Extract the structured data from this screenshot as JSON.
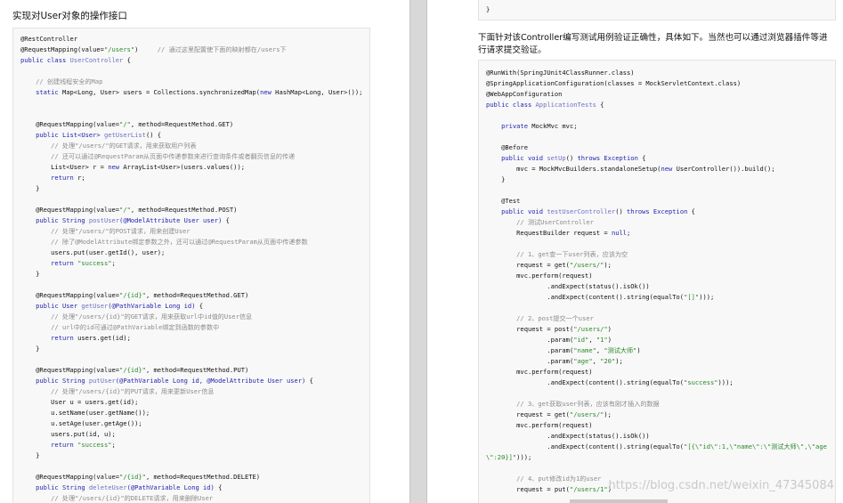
{
  "left_page": {
    "heading": "实现对User对象的操作接口",
    "lines": [
      [
        {
          "t": "@RestController",
          "c": "ann"
        }
      ],
      [
        {
          "t": "@RequestMapping(value=",
          "c": "ann"
        },
        {
          "t": "\"/users\"",
          "c": "str"
        },
        {
          "t": ")",
          "c": "ann"
        },
        {
          "t": "     // 通过这里配置使下面的映射都在/users下",
          "c": "cm"
        }
      ],
      [
        {
          "t": "public class ",
          "c": "kw"
        },
        {
          "t": "UserController",
          "c": "fn"
        },
        {
          "t": " {",
          "c": ""
        }
      ],
      [],
      [
        {
          "t": "    // 创建线程安全的Map",
          "c": "cm"
        }
      ],
      [
        {
          "t": "    static ",
          "c": "kw"
        },
        {
          "t": "Map<Long, User> users = Collections.synchronizedMap(",
          "c": ""
        },
        {
          "t": "new ",
          "c": "kw"
        },
        {
          "t": "HashMap<Long, User>());",
          "c": ""
        }
      ],
      [],
      [],
      [
        {
          "t": "    @RequestMapping(value=",
          "c": "ann"
        },
        {
          "t": "\"/\"",
          "c": "str"
        },
        {
          "t": ", method=RequestMethod.GET)",
          "c": "ann"
        }
      ],
      [
        {
          "t": "    public ",
          "c": "kw"
        },
        {
          "t": "List<User>",
          "c": "ty"
        },
        {
          "t": " getUserList",
          "c": "fn"
        },
        {
          "t": "() {",
          "c": ""
        }
      ],
      [
        {
          "t": "        // 处理\"/users/\"的GET请求，用来获取用户列表",
          "c": "cm"
        }
      ],
      [
        {
          "t": "        // 还可以通过@RequestParam从页面中传递参数来进行查询条件或者翻页信息的传递",
          "c": "cm"
        }
      ],
      [
        {
          "t": "        List<User> r = ",
          "c": ""
        },
        {
          "t": "new ",
          "c": "kw"
        },
        {
          "t": "ArrayList<User>(users.values());",
          "c": ""
        }
      ],
      [
        {
          "t": "        return ",
          "c": "kw"
        },
        {
          "t": "r;",
          "c": ""
        }
      ],
      [
        {
          "t": "    }",
          "c": ""
        }
      ],
      [],
      [
        {
          "t": "    @RequestMapping(value=",
          "c": "ann"
        },
        {
          "t": "\"/\"",
          "c": "str"
        },
        {
          "t": ", method=RequestMethod.POST)",
          "c": "ann"
        }
      ],
      [
        {
          "t": "    public ",
          "c": "kw"
        },
        {
          "t": "String",
          "c": "ty"
        },
        {
          "t": " postUser",
          "c": "fn"
        },
        {
          "t": "(@ModelAttribute User user)",
          "c": "kw"
        },
        {
          "t": " {",
          "c": ""
        }
      ],
      [
        {
          "t": "        // 处理\"/users/\"的POST请求，用来创建User",
          "c": "cm"
        }
      ],
      [
        {
          "t": "        // 除了@ModelAttribute绑定参数之外，还可以通过@RequestParam从页面中传递参数",
          "c": "cm"
        }
      ],
      [
        {
          "t": "        users.put(user.getId(), user);",
          "c": ""
        }
      ],
      [
        {
          "t": "        return ",
          "c": "kw"
        },
        {
          "t": "\"success\"",
          "c": "str"
        },
        {
          "t": ";",
          "c": ""
        }
      ],
      [
        {
          "t": "    }",
          "c": ""
        }
      ],
      [],
      [
        {
          "t": "    @RequestMapping(value=",
          "c": "ann"
        },
        {
          "t": "\"/{id}\"",
          "c": "str"
        },
        {
          "t": ", method=RequestMethod.GET)",
          "c": "ann"
        }
      ],
      [
        {
          "t": "    public ",
          "c": "kw"
        },
        {
          "t": "User",
          "c": "ty"
        },
        {
          "t": " getUser",
          "c": "fn"
        },
        {
          "t": "(@PathVariable Long id)",
          "c": "kw"
        },
        {
          "t": " {",
          "c": ""
        }
      ],
      [
        {
          "t": "        // 处理\"/users/{id}\"的GET请求，用来获取url中id值的User信息",
          "c": "cm"
        }
      ],
      [
        {
          "t": "        // url中的id可通过@PathVariable绑定到函数的参数中",
          "c": "cm"
        }
      ],
      [
        {
          "t": "        return ",
          "c": "kw"
        },
        {
          "t": "users.get(id);",
          "c": ""
        }
      ],
      [
        {
          "t": "    }",
          "c": ""
        }
      ],
      [],
      [
        {
          "t": "    @RequestMapping(value=",
          "c": "ann"
        },
        {
          "t": "\"/{id}\"",
          "c": "str"
        },
        {
          "t": ", method=RequestMethod.PUT)",
          "c": "ann"
        }
      ],
      [
        {
          "t": "    public ",
          "c": "kw"
        },
        {
          "t": "String",
          "c": "ty"
        },
        {
          "t": " putUser",
          "c": "fn"
        },
        {
          "t": "(@PathVariable Long id, @ModelAttribute User user)",
          "c": "kw"
        },
        {
          "t": " {",
          "c": ""
        }
      ],
      [
        {
          "t": "        // 处理\"/users/{id}\"的PUT请求，用来更新User信息",
          "c": "cm"
        }
      ],
      [
        {
          "t": "        User u = users.get(id);",
          "c": ""
        }
      ],
      [
        {
          "t": "        u.setName(user.getName());",
          "c": ""
        }
      ],
      [
        {
          "t": "        u.setAge(user.getAge());",
          "c": ""
        }
      ],
      [
        {
          "t": "        users.put(id, u);",
          "c": ""
        }
      ],
      [
        {
          "t": "        return ",
          "c": "kw"
        },
        {
          "t": "\"success\"",
          "c": "str"
        },
        {
          "t": ";",
          "c": ""
        }
      ],
      [
        {
          "t": "    }",
          "c": ""
        }
      ],
      [],
      [
        {
          "t": "    @RequestMapping(value=",
          "c": "ann"
        },
        {
          "t": "\"/{id}\"",
          "c": "str"
        },
        {
          "t": ", method=RequestMethod.DELETE)",
          "c": "ann"
        }
      ],
      [
        {
          "t": "    public ",
          "c": "kw"
        },
        {
          "t": "String",
          "c": "ty"
        },
        {
          "t": " deleteUser",
          "c": "fn"
        },
        {
          "t": "(@PathVariable Long id)",
          "c": "kw"
        },
        {
          "t": " {",
          "c": ""
        }
      ],
      [
        {
          "t": "        // 处理\"/users/{id}\"的DELETE请求，用来删除User",
          "c": "cm"
        }
      ]
    ]
  },
  "right_page": {
    "top_lines": [
      [
        {
          "t": "}",
          "c": ""
        }
      ]
    ],
    "intro": "下面针对该Controller编写测试用例验证正确性，具体如下。当然也可以通过浏览器插件等进行请求提交验证。",
    "lines": [
      [
        {
          "t": "@RunWith(SpringJUnit4ClassRunner.class)",
          "c": "ann"
        }
      ],
      [
        {
          "t": "@SpringApplicationConfiguration(classes = MockServletContext.class)",
          "c": "ann"
        }
      ],
      [
        {
          "t": "@WebAppConfiguration",
          "c": "ann"
        }
      ],
      [
        {
          "t": "public class ",
          "c": "kw"
        },
        {
          "t": "ApplicationTests",
          "c": "fn"
        },
        {
          "t": " {",
          "c": ""
        }
      ],
      [],
      [
        {
          "t": "    private ",
          "c": "kw"
        },
        {
          "t": "MockMvc mvc;",
          "c": ""
        }
      ],
      [],
      [
        {
          "t": "    @Before",
          "c": "ann"
        }
      ],
      [
        {
          "t": "    public void ",
          "c": "kw"
        },
        {
          "t": "setUp",
          "c": "fn"
        },
        {
          "t": "() ",
          "c": ""
        },
        {
          "t": "throws Exception",
          "c": "kw"
        },
        {
          "t": " {",
          "c": ""
        }
      ],
      [
        {
          "t": "        mvc = MockMvcBuilders.standaloneSetup(",
          "c": ""
        },
        {
          "t": "new ",
          "c": "kw"
        },
        {
          "t": "UserController()).build();",
          "c": ""
        }
      ],
      [
        {
          "t": "    }",
          "c": ""
        }
      ],
      [],
      [
        {
          "t": "    @Test",
          "c": "ann"
        }
      ],
      [
        {
          "t": "    public void ",
          "c": "kw"
        },
        {
          "t": "testUserController",
          "c": "fn"
        },
        {
          "t": "() ",
          "c": ""
        },
        {
          "t": "throws Exception",
          "c": "kw"
        },
        {
          "t": " {",
          "c": ""
        }
      ],
      [
        {
          "t": "        // 测试UserController",
          "c": "cm"
        }
      ],
      [
        {
          "t": "        RequestBuilder request = ",
          "c": ""
        },
        {
          "t": "null",
          "c": "kw"
        },
        {
          "t": ";",
          "c": ""
        }
      ],
      [],
      [
        {
          "t": "        // 1、get查一下user列表，应该为空",
          "c": "cm"
        }
      ],
      [
        {
          "t": "        request = get(",
          "c": ""
        },
        {
          "t": "\"/users/\"",
          "c": "str"
        },
        {
          "t": ");",
          "c": ""
        }
      ],
      [
        {
          "t": "        mvc.perform(request)",
          "c": ""
        }
      ],
      [
        {
          "t": "                .andExpect(status().isOk())",
          "c": ""
        }
      ],
      [
        {
          "t": "                .andExpect(content().string(equalTo(",
          "c": ""
        },
        {
          "t": "\"[]\"",
          "c": "str"
        },
        {
          "t": ")));",
          "c": ""
        }
      ],
      [],
      [
        {
          "t": "        // 2、post提交一个user",
          "c": "cm"
        }
      ],
      [
        {
          "t": "        request = post(",
          "c": ""
        },
        {
          "t": "\"/users/\"",
          "c": "str"
        },
        {
          "t": ")",
          "c": ""
        }
      ],
      [
        {
          "t": "                .param(",
          "c": ""
        },
        {
          "t": "\"id\"",
          "c": "str"
        },
        {
          "t": ", ",
          "c": ""
        },
        {
          "t": "\"1\"",
          "c": "str"
        },
        {
          "t": ")",
          "c": ""
        }
      ],
      [
        {
          "t": "                .param(",
          "c": ""
        },
        {
          "t": "\"name\"",
          "c": "str"
        },
        {
          "t": ", ",
          "c": ""
        },
        {
          "t": "\"测试大师\"",
          "c": "str"
        },
        {
          "t": ")",
          "c": ""
        }
      ],
      [
        {
          "t": "                .param(",
          "c": ""
        },
        {
          "t": "\"age\"",
          "c": "str"
        },
        {
          "t": ", ",
          "c": ""
        },
        {
          "t": "\"20\"",
          "c": "str"
        },
        {
          "t": ");",
          "c": ""
        }
      ],
      [
        {
          "t": "        mvc.perform(request)",
          "c": ""
        }
      ],
      [
        {
          "t": "                .andExpect(content().string(equalTo(",
          "c": ""
        },
        {
          "t": "\"success\"",
          "c": "str"
        },
        {
          "t": ")));",
          "c": ""
        }
      ],
      [],
      [
        {
          "t": "        // 3、get获取user列表，应该有刚才插入的数据",
          "c": "cm"
        }
      ],
      [
        {
          "t": "        request = get(",
          "c": ""
        },
        {
          "t": "\"/users/\"",
          "c": "str"
        },
        {
          "t": ");",
          "c": ""
        }
      ],
      [
        {
          "t": "        mvc.perform(request)",
          "c": ""
        }
      ],
      [
        {
          "t": "                .andExpect(status().isOk())",
          "c": ""
        }
      ],
      [
        {
          "t": "                .andExpect(content().string(equalTo(",
          "c": ""
        },
        {
          "t": "\"[{\\\"id\\\":1,\\\"name\\\":\\\"测试大师\\\",\\\"age",
          "c": "str"
        }
      ],
      [
        {
          "t": "\\\":20}]\"",
          "c": "str"
        },
        {
          "t": ")));",
          "c": ""
        }
      ],
      [],
      [
        {
          "t": "        // 4、put修改id为1的user",
          "c": "cm"
        }
      ],
      [
        {
          "t": "        request = put(",
          "c": ""
        },
        {
          "t": "\"/users/1\"",
          "c": "str"
        },
        {
          "t": ")",
          "c": ""
        }
      ]
    ],
    "watermark": "https://blog.csdn.net/weixin_47345084"
  }
}
